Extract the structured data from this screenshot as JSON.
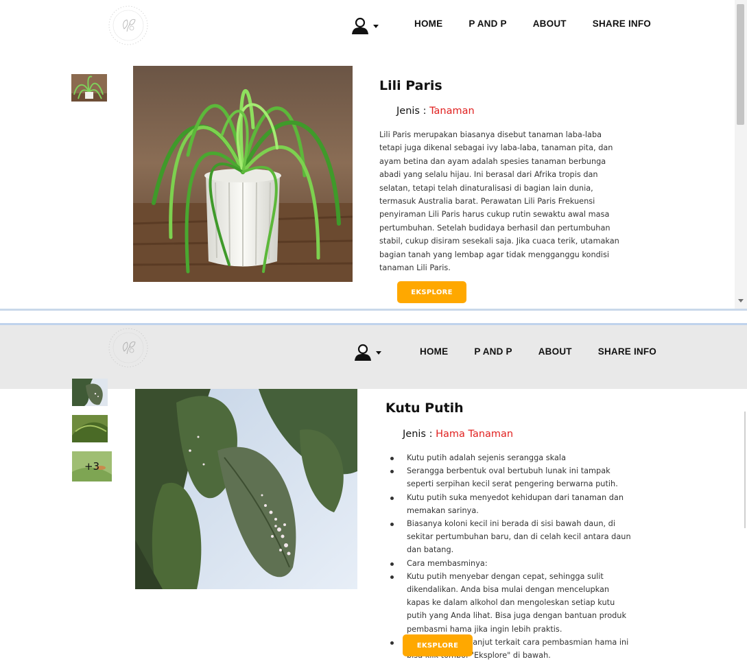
{
  "colors": {
    "accent_red": "#e0201f",
    "button_orange": "#ffa800",
    "navbar2_bg": "#e9e9e9",
    "divider": "#c9d8ea"
  },
  "navbar": {
    "items": [
      "HOME",
      "P AND P",
      "ABOUT",
      "SHARE INFO"
    ],
    "user_icon": "user-icon",
    "logo_icon": "floral-logo-icon"
  },
  "panel1": {
    "title": "Lili Paris",
    "jenis_label": "Jenis : ",
    "jenis_value": "Tanaman",
    "description": "Lili Paris merupakan biasanya disebut tanaman laba-laba tetapi juga dikenal sebagai ivy laba-laba, tanaman pita, dan ayam betina dan ayam adalah spesies tanaman berbunga abadi yang selalu hijau. Ini berasal dari Afrika tropis dan selatan, tetapi telah dinaturalisasi di bagian lain dunia, termasuk Australia barat. Perawatan Lili Paris Frekuensi penyiraman Lili Paris harus cukup rutin sewaktu awal masa pertumbuhan. Setelah budidaya berhasil dan pertumbuhan stabil, cukup disiram sesekali saja. Jika cuaca terik, utamakan bagian tanah yang lembap agar tidak mengganggu kondisi tanaman Lili Paris.",
    "button": "EKSPLORE"
  },
  "panel2": {
    "title": "Kutu Putih",
    "jenis_label": "Jenis : ",
    "jenis_value": "Hama Tanaman",
    "more_badge": "+3",
    "bullets": [
      "Kutu putih adalah sejenis serangga skala",
      "Serangga berbentuk oval bertubuh lunak ini tampak seperti serpihan kecil serat pengering berwarna putih.",
      "Kutu putih suka menyedot kehidupan dari tanaman dan memakan sarinya.",
      "Biasanya koloni kecil ini berada di sisi bawah daun, di sekitar pertumbuhan baru, dan di celah kecil antara daun dan batang.",
      "Cara membasminya:",
      "Kutu putih menyebar dengan cepat, sehingga sulit dikendalikan. Anda bisa mulai dengan mencelupkan kapas ke dalam alkohol dan mengoleskan setiap kutu putih yang Anda lihat. Bisa juga dengan bantuan produk pembasmi hama jika ingin lebih praktis.",
      "Untuk info lebih lanjut terkait cara pembasmian hama ini bisa klik tombol \"Eksplore\" di bawah."
    ],
    "button": "EKSPLORE"
  }
}
